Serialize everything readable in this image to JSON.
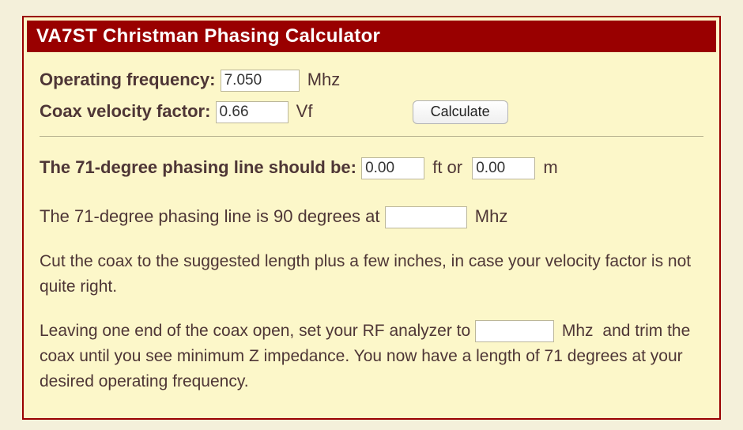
{
  "title": "VA7ST Christman Phasing Calculator",
  "inputs": {
    "operating_frequency": {
      "label": "Operating frequency:",
      "value": "7.050",
      "unit": "Mhz"
    },
    "velocity_factor": {
      "label": "Coax velocity factor:",
      "value": "0.66",
      "unit": "Vf"
    }
  },
  "calculate_label": "Calculate",
  "result": {
    "heading": "The 71-degree phasing line should be:",
    "ft_value": "0.00",
    "ft_unit": "ft or",
    "m_value": "0.00",
    "m_unit": "m"
  },
  "line90": {
    "prefix": "The 71-degree phasing line is 90 degrees at",
    "value": "",
    "unit": "Mhz"
  },
  "advice1": "Cut the coax to the suggested length plus a few inches, in case your velocity factor is not quite right.",
  "advice2_a": "Leaving one end of the coax open, set your RF analyzer to",
  "advice2_value": "",
  "advice2_unit": "Mhz",
  "advice2_b": "and trim the coax until you see minimum Z impedance. You now have a length of 71 degrees at your desired operating frequency."
}
